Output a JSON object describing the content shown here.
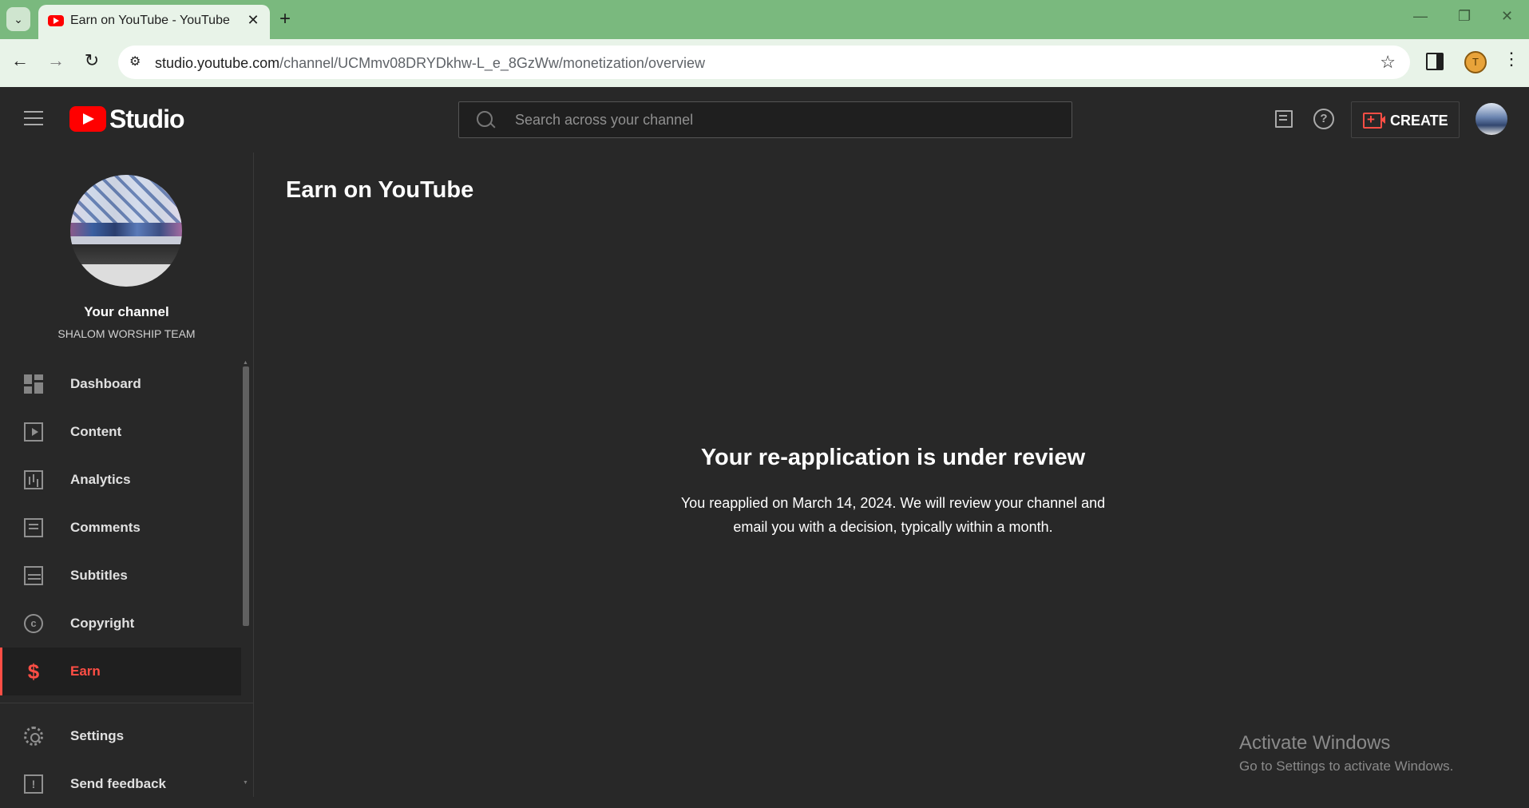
{
  "browser": {
    "tab_title": "Earn on YouTube - YouTube Studio",
    "url_host": "studio.youtube.com",
    "url_path": "/channel/UCMmv08DRYDkhw-L_e_8GzWw/monetization/overview",
    "new_tab_glyph": "+",
    "close_glyph": "✕"
  },
  "header": {
    "logo_text": "Studio",
    "search_placeholder": "Search across your channel",
    "create_label": "CREATE"
  },
  "sidebar": {
    "channel_title": "Your channel",
    "channel_name": "SHALOM WORSHIP TEAM",
    "items": [
      {
        "label": "Dashboard",
        "icon": "dashboard-icon"
      },
      {
        "label": "Content",
        "icon": "content-icon"
      },
      {
        "label": "Analytics",
        "icon": "analytics-icon"
      },
      {
        "label": "Comments",
        "icon": "comments-icon"
      },
      {
        "label": "Subtitles",
        "icon": "subtitles-icon"
      },
      {
        "label": "Copyright",
        "icon": "copyright-icon"
      },
      {
        "label": "Earn",
        "icon": "earn-icon",
        "active": true
      }
    ],
    "bottom_items": [
      {
        "label": "Settings",
        "icon": "settings-icon"
      },
      {
        "label": "Send feedback",
        "icon": "feedback-icon"
      }
    ]
  },
  "main": {
    "page_title": "Earn on YouTube",
    "review_title": "Your re-application is under review",
    "review_text": "You reapplied on March 14, 2024. We will review your channel and email you with a decision, typically within a month."
  },
  "watermark": {
    "title": "Activate Windows",
    "subtitle": "Go to Settings to activate Windows."
  },
  "colors": {
    "accent": "#ff4e45",
    "background": "#282828",
    "tabstrip": "#7ab97e"
  }
}
